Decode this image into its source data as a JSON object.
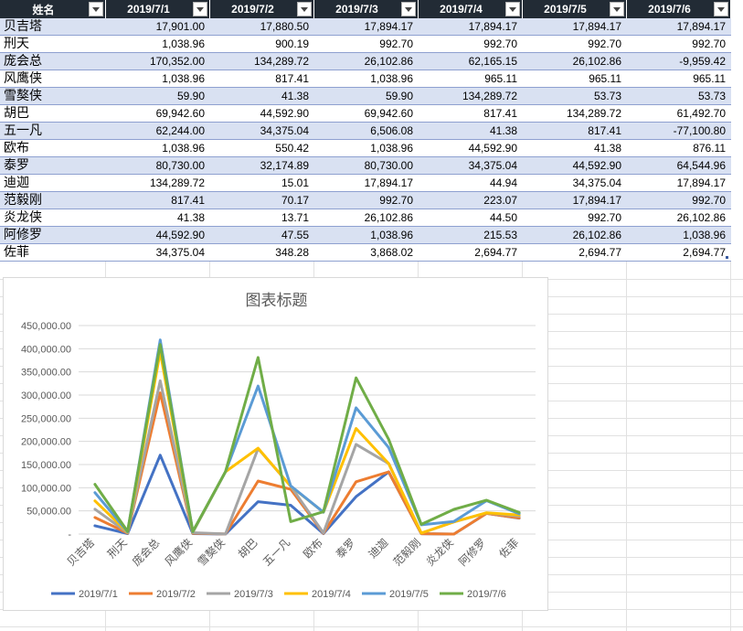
{
  "columns": [
    "姓名",
    "2019/7/1",
    "2019/7/2",
    "2019/7/3",
    "2019/7/4",
    "2019/7/5",
    "2019/7/6"
  ],
  "rows": [
    {
      "name": "贝吉塔",
      "values": [
        "17,901.00",
        "17,880.50",
        "17,894.17",
        "17,894.17",
        "17,894.17",
        "17,894.17"
      ]
    },
    {
      "name": "刑天",
      "values": [
        "1,038.96",
        "900.19",
        "992.70",
        "992.70",
        "992.70",
        "992.70"
      ]
    },
    {
      "name": "庞会总",
      "values": [
        "170,352.00",
        "134,289.72",
        "26,102.86",
        "62,165.15",
        "26,102.86",
        "-9,959.42"
      ]
    },
    {
      "name": "风鹰侠",
      "values": [
        "1,038.96",
        "817.41",
        "1,038.96",
        "965.11",
        "965.11",
        "965.11"
      ]
    },
    {
      "name": "雪獒侠",
      "values": [
        "59.90",
        "41.38",
        "59.90",
        "134,289.72",
        "53.73",
        "53.73"
      ]
    },
    {
      "name": "胡巴",
      "values": [
        "69,942.60",
        "44,592.90",
        "69,942.60",
        "817.41",
        "134,289.72",
        "61,492.70"
      ]
    },
    {
      "name": "五一凡",
      "values": [
        "62,244.00",
        "34,375.04",
        "6,506.08",
        "41.38",
        "817.41",
        "-77,100.80"
      ]
    },
    {
      "name": "欧布",
      "values": [
        "1,038.96",
        "550.42",
        "1,038.96",
        "44,592.90",
        "41.38",
        "876.11"
      ]
    },
    {
      "name": "泰罗",
      "values": [
        "80,730.00",
        "32,174.89",
        "80,730.00",
        "34,375.04",
        "44,592.90",
        "64,544.96"
      ]
    },
    {
      "name": "迪迦",
      "values": [
        "134,289.72",
        "15.01",
        "17,894.17",
        "44.94",
        "34,375.04",
        "17,894.17"
      ]
    },
    {
      "name": "范毅刚",
      "values": [
        "817.41",
        "70.17",
        "992.70",
        "223.07",
        "17,894.17",
        "992.70"
      ]
    },
    {
      "name": "炎龙侠",
      "values": [
        "41.38",
        "13.71",
        "26,102.86",
        "44.50",
        "992.70",
        "26,102.86"
      ]
    },
    {
      "name": "阿修罗",
      "values": [
        "44,592.90",
        "47.55",
        "1,038.96",
        "215.53",
        "26,102.86",
        "1,038.96"
      ]
    },
    {
      "name": "佐菲",
      "values": [
        "34,375.04",
        "348.28",
        "3,868.02",
        "2,694.77",
        "2,694.77",
        "2,694.77"
      ]
    }
  ],
  "chart_data": {
    "type": "line",
    "stacked": true,
    "title": "图表标题",
    "categories": [
      "贝吉塔",
      "刑天",
      "庞会总",
      "风鹰侠",
      "雪獒侠",
      "胡巴",
      "五一凡",
      "欧布",
      "泰罗",
      "迪迦",
      "范毅刚",
      "炎龙侠",
      "阿修罗",
      "佐菲"
    ],
    "series": [
      {
        "name": "2019/7/1",
        "color": "#4472c4",
        "values": [
          17901.0,
          1038.96,
          170352.0,
          1038.96,
          59.9,
          69942.6,
          62244.0,
          1038.96,
          80730.0,
          134289.72,
          817.41,
          41.38,
          44592.9,
          34375.04
        ]
      },
      {
        "name": "2019/7/2",
        "color": "#ed7d31",
        "values": [
          17880.5,
          900.19,
          134289.72,
          817.41,
          41.38,
          44592.9,
          34375.04,
          550.42,
          32174.89,
          15.01,
          70.17,
          13.71,
          47.55,
          348.28
        ]
      },
      {
        "name": "2019/7/3",
        "color": "#a5a5a5",
        "values": [
          17894.17,
          992.7,
          26102.86,
          1038.96,
          59.9,
          69942.6,
          6506.08,
          1038.96,
          80730.0,
          17894.17,
          992.7,
          26102.86,
          1038.96,
          3868.02
        ]
      },
      {
        "name": "2019/7/4",
        "color": "#ffc000",
        "values": [
          17894.17,
          992.7,
          62165.15,
          965.11,
          134289.72,
          817.41,
          41.38,
          44592.9,
          34375.04,
          44.94,
          223.07,
          44.5,
          215.53,
          2694.77
        ]
      },
      {
        "name": "2019/7/5",
        "color": "#5b9bd5",
        "values": [
          17894.17,
          992.7,
          26102.86,
          965.11,
          53.73,
          134289.72,
          817.41,
          41.38,
          44592.9,
          34375.04,
          17894.17,
          992.7,
          26102.86,
          2694.77
        ]
      },
      {
        "name": "2019/7/6",
        "color": "#70ad47",
        "values": [
          17894.17,
          992.7,
          -9959.42,
          965.11,
          53.73,
          61492.7,
          -77100.8,
          876.11,
          64544.96,
          17894.17,
          992.7,
          26102.86,
          1038.96,
          2694.77
        ]
      }
    ],
    "yticks": [
      "-",
      "50,000.00",
      "100,000.00",
      "150,000.00",
      "200,000.00",
      "250,000.00",
      "300,000.00",
      "350,000.00",
      "400,000.00",
      "450,000.00"
    ],
    "ylim": [
      0,
      450000
    ],
    "grid": true,
    "legend": "bottom"
  }
}
